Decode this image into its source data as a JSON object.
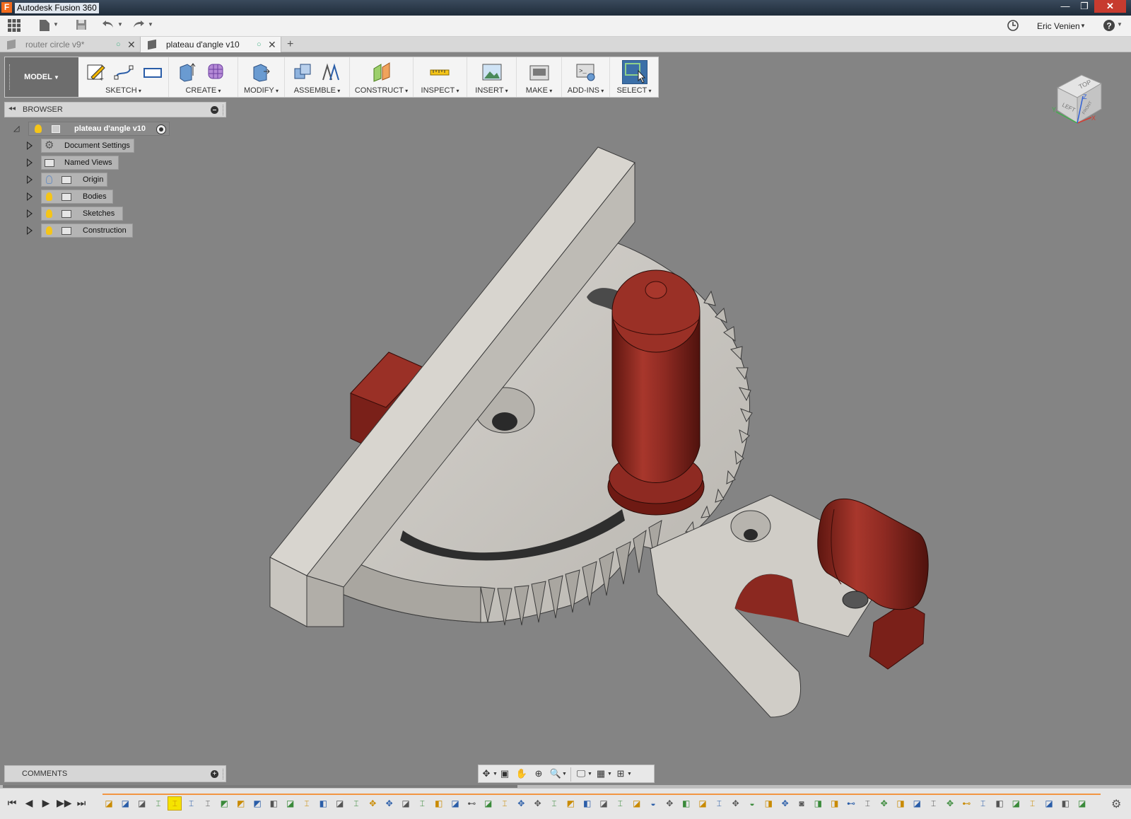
{
  "app": {
    "title": "Autodesk Fusion 360",
    "logo_letter": "F"
  },
  "window_controls": {
    "minimize": "—",
    "restore": "❐",
    "close": "✕"
  },
  "quick_access": {
    "user_name": "Eric Venien",
    "icons": [
      "data-panel-icon",
      "file-icon",
      "save-icon",
      "undo-icon",
      "redo-icon",
      "job-status-icon",
      "help-icon"
    ]
  },
  "tabs": [
    {
      "label": "router circle v9*",
      "active": false
    },
    {
      "label": "plateau d'angle v10",
      "active": true
    }
  ],
  "toolbar": {
    "workspace": "MODEL",
    "groups": [
      {
        "label": "SKETCH"
      },
      {
        "label": "CREATE"
      },
      {
        "label": "MODIFY"
      },
      {
        "label": "ASSEMBLE"
      },
      {
        "label": "CONSTRUCT"
      },
      {
        "label": "INSPECT"
      },
      {
        "label": "INSERT"
      },
      {
        "label": "MAKE"
      },
      {
        "label": "ADD-INS"
      },
      {
        "label": "SELECT"
      }
    ]
  },
  "browser": {
    "title": "BROWSER",
    "root": {
      "label": "plateau d'angle v10"
    },
    "items": [
      {
        "label": "Document Settings",
        "icon": "gear-icon",
        "visibility": "none"
      },
      {
        "label": "Named Views",
        "icon": "folder-icon",
        "visibility": "none"
      },
      {
        "label": "Origin",
        "icon": "folder-icon",
        "visibility": "hidden"
      },
      {
        "label": "Bodies",
        "icon": "folder-icon",
        "visibility": "visible"
      },
      {
        "label": "Sketches",
        "icon": "folder-icon",
        "visibility": "visible"
      },
      {
        "label": "Construction",
        "icon": "folder-icon",
        "visibility": "visible"
      }
    ]
  },
  "viewcube": {
    "top": "TOP",
    "left": "LEFT",
    "front": "FRONT",
    "axis_x": "X",
    "axis_y": "Y",
    "axis_z": "Z"
  },
  "comments": {
    "title": "COMMENTS"
  },
  "colors": {
    "accent_select": "#3b6fa7",
    "timeline_marker": "#f29642",
    "model_body": "#c9c6c0",
    "model_red": "#8e2a22",
    "viewport_bg": "#848484"
  },
  "timeline": {
    "controls": [
      "⏮",
      "◀",
      "▶",
      "▶▶",
      "⏭"
    ],
    "selected_index": 4,
    "feature_count": 60
  }
}
